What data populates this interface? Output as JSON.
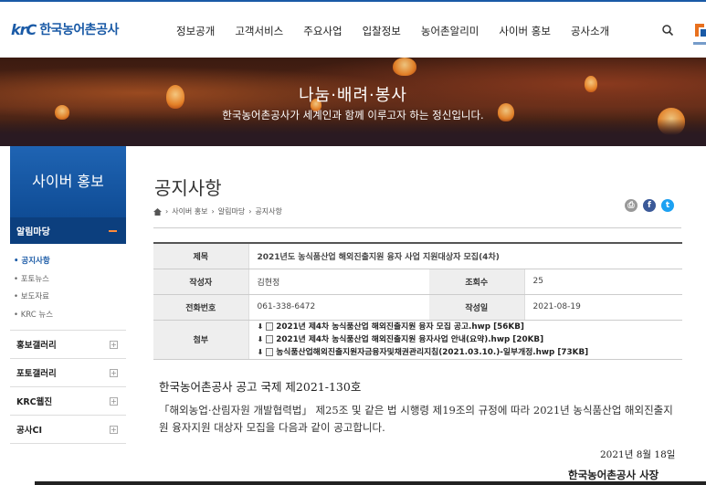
{
  "header": {
    "logo_mark": "krC",
    "logo_text": "한국농어촌공사",
    "nav": [
      "정보공개",
      "고객서비스",
      "주요사업",
      "입찰정보",
      "농어촌알리미",
      "사이버 홍보",
      "공사소개"
    ]
  },
  "banner": {
    "title": "나눔·배려·봉사",
    "subtitle": "한국농어촌공사가 세계인과 함께 이루고자 하는 정신입니다."
  },
  "sidebar": {
    "heading": "사이버 홍보",
    "active_group": "알림마당",
    "sub_items": [
      "공지사항",
      "포토뉴스",
      "보도자료",
      "KRC 뉴스"
    ],
    "groups": [
      "홍보갤러리",
      "포토갤러리",
      "KRC웹진",
      "공사CI"
    ]
  },
  "content": {
    "page_title": "공지사항",
    "breadcrumb": [
      "사이버 홍보",
      "알림마당",
      "공지사항"
    ],
    "table": {
      "title_label": "제목",
      "title_value": "2021년도 농식품산업 해외진출지원 융자 사업 지원대상자 모집(4차)",
      "author_label": "작성자",
      "author_value": "김현정",
      "views_label": "조회수",
      "views_value": "25",
      "phone_label": "전화번호",
      "phone_value": "061-338-6472",
      "date_label": "작성일",
      "date_value": "2021-08-19",
      "attach_label": "첨부",
      "files": [
        "2021년 제4차 농식품산업 해외진출지원 융자 모집 공고.hwp  [56KB]",
        "2021년 제4차 농식품산업 해외진출지원 융자사업 안내(요약).hwp  [20KB]",
        "농식품산업해외진출지원자금융자및채권관리지침(2021.03.10.)-일부개정.hwp  [73KB]"
      ]
    },
    "doc": {
      "number": "한국농어촌공사 공고 국제 제2021-130호",
      "body": "「해외농업·산림자원 개발협력법」 제25조 및 같은 법 시행령 제19조의 규정에 따라 2021년 농식품산업 해외진출지원 융자지원 대상자 모집을 다음과 같이 공고합니다.",
      "date": "2021년 8월 18일",
      "signer": "한국농어촌공사 사장"
    }
  },
  "colors": {
    "brand_blue": "#1a5aa6",
    "side_dark": "#0c3f7e",
    "accent_orange": "#ff8a3a"
  },
  "icons": [
    "search-icon",
    "home-icon",
    "print-icon",
    "facebook-icon",
    "twitter-icon",
    "download-icon",
    "hwp-file-icon",
    "plus-icon",
    "minus-icon"
  ]
}
